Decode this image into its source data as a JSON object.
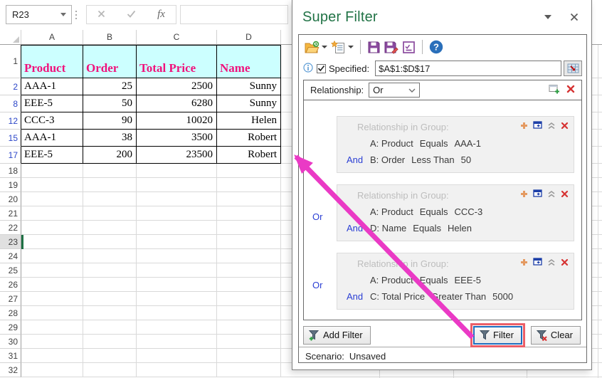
{
  "formula": {
    "name_box": "R23",
    "fx_label": "fx"
  },
  "sheet": {
    "columns": [
      "A",
      "B",
      "C",
      "D"
    ],
    "header_row": {
      "row": "1",
      "cells": [
        "Product",
        "Order",
        "Total Price",
        "Name"
      ]
    },
    "data_rows": [
      {
        "row": "2",
        "cells": [
          "AAA-1",
          "25",
          "2500",
          "Sunny"
        ]
      },
      {
        "row": "8",
        "cells": [
          "EEE-5",
          "50",
          "6280",
          "Sunny"
        ]
      },
      {
        "row": "12",
        "cells": [
          "CCC-3",
          "90",
          "10020",
          "Helen"
        ]
      },
      {
        "row": "15",
        "cells": [
          "AAA-1",
          "38",
          "3500",
          "Robert"
        ]
      },
      {
        "row": "17",
        "cells": [
          "EEE-5",
          "200",
          "23500",
          "Robert"
        ]
      }
    ],
    "empty_rows": [
      "18",
      "19",
      "20",
      "21",
      "22",
      "23",
      "24",
      "25",
      "26",
      "27",
      "28",
      "29",
      "30",
      "31",
      "32"
    ],
    "selected_row": "23"
  },
  "panel": {
    "title": "Super Filter",
    "specified": {
      "label": "Specified:",
      "range": "$A$1:$D$17",
      "checked": true
    },
    "relationship": {
      "label": "Relationship:",
      "value": "Or"
    },
    "groups": [
      {
        "connector": "",
        "header": "Relationship in Group:",
        "rows": [
          {
            "and": "",
            "col": "A: Product",
            "op": "Equals",
            "val": "AAA-1"
          },
          {
            "and": "And",
            "col": "B: Order",
            "op": "Less Than",
            "val": "50"
          }
        ]
      },
      {
        "connector": "Or",
        "header": "Relationship in Group:",
        "rows": [
          {
            "and": "",
            "col": "A: Product",
            "op": "Equals",
            "val": "CCC-3"
          },
          {
            "and": "And",
            "col": "D: Name",
            "op": "Equals",
            "val": "Helen"
          }
        ]
      },
      {
        "connector": "Or",
        "header": "Relationship in Group:",
        "rows": [
          {
            "and": "",
            "col": "A: Product",
            "op": "Equals",
            "val": "EEE-5"
          },
          {
            "and": "And",
            "col": "C: Total Price",
            "op": "Greater Than",
            "val": "5000"
          }
        ]
      }
    ],
    "buttons": {
      "add_filter": "Add Filter",
      "filter": "Filter",
      "clear": "Clear"
    },
    "scenario_label": "Scenario:",
    "scenario_value": "Unsaved"
  },
  "colors": {
    "table_header_bg": "#ccffff",
    "table_header_text": "#f0127c",
    "panel_title": "#217346",
    "filtered_row_number": "#2c46c8",
    "connector_text": "#2b3fd4",
    "arrow": "#ea3ac5",
    "annotation_box": "#ec5f68",
    "filter_focus_border": "#1f6dbf"
  },
  "icons": {
    "toolbar": [
      "open-scenario-icon",
      "new-scenario-icon",
      "save-scenario-icon",
      "save-as-scenario-icon",
      "manage-scenario-icon",
      "help-icon"
    ],
    "specified_row": [
      "info-icon",
      "specified-checkbox",
      "range-select-icon"
    ],
    "relationship_row": [
      "add-group-icon",
      "delete-all-icon"
    ],
    "group": [
      "add-condition-icon",
      "move-group-icon",
      "collapse-group-icon",
      "delete-group-icon"
    ],
    "buttons": [
      "add-filter-funnel-icon",
      "filter-funnel-icon",
      "clear-funnel-icon"
    ]
  }
}
